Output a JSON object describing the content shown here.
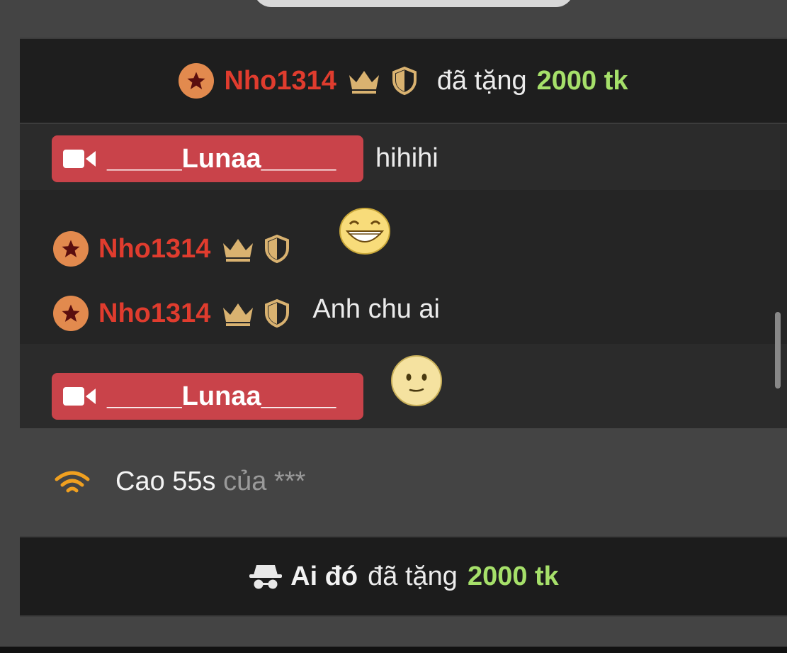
{
  "gift_banner": {
    "username": "Nho1314",
    "gave_text": "đã tặng",
    "amount": "2000 tk"
  },
  "messages": [
    {
      "type": "streamer",
      "username": "_____Lunaa_____",
      "text": "hihihi"
    },
    {
      "type": "user",
      "username": "Nho1314",
      "content": "grinning-emoji"
    },
    {
      "type": "user",
      "username": "Nho1314",
      "text": "Anh chu ai"
    },
    {
      "type": "streamer",
      "username": "_____Lunaa_____",
      "content": "neutral-face-emoji"
    }
  ],
  "system": {
    "main": "Cao 55s",
    "suffix": "của ***"
  },
  "anon_gift": {
    "username": "Ai đó",
    "gave_text": "đã tặng",
    "amount": "2000 tk"
  },
  "colors": {
    "username_red": "#e03c2e",
    "amount_green": "#a6e06a",
    "streamer_pill": "#c9434a",
    "badge_orange": "#e28a4e",
    "crown_gold": "#d9b270",
    "wifi_orange": "#f0a020"
  }
}
